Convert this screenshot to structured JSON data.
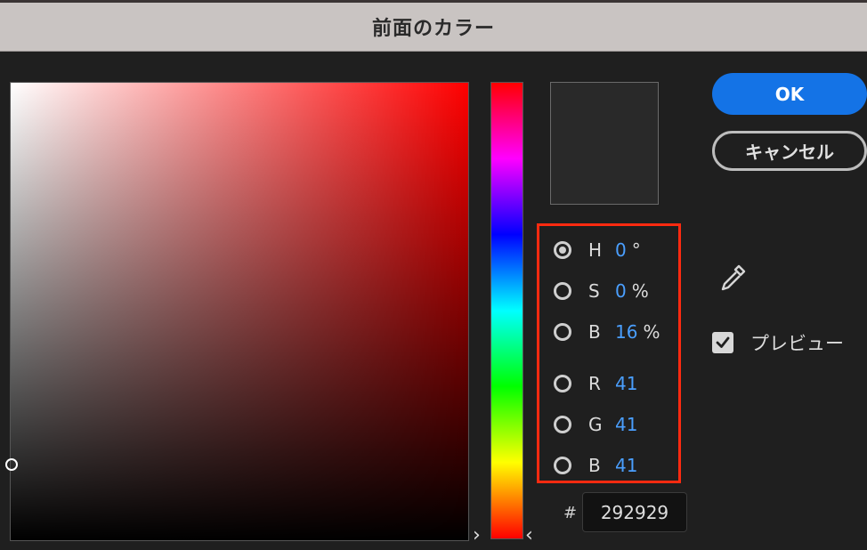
{
  "dialog": {
    "title": "前面のカラー"
  },
  "buttons": {
    "ok": "OK",
    "cancel": "キャンセル"
  },
  "color": {
    "preview": "#292929",
    "base_hue": "#ff0000"
  },
  "fields": [
    {
      "label": "H",
      "value": "0",
      "unit": "°",
      "selected": true
    },
    {
      "label": "S",
      "value": "0",
      "unit": "%",
      "selected": false
    },
    {
      "label": "B",
      "value": "16",
      "unit": "%",
      "selected": false
    },
    {
      "label": "R",
      "value": "41",
      "unit": "",
      "selected": false
    },
    {
      "label": "G",
      "value": "41",
      "unit": "",
      "selected": false
    },
    {
      "label": "B",
      "value": "41",
      "unit": "",
      "selected": false
    }
  ],
  "hex": {
    "prefix": "#",
    "value": "292929"
  },
  "preview": {
    "label": "プレビュー",
    "checked": true
  },
  "icons": {
    "eyedropper": "eyedropper-icon",
    "check": "checkmark-icon"
  },
  "accents": {
    "highlight_box": "#ff2a10",
    "button": "#1473e6",
    "value_text": "#4a9fff"
  }
}
